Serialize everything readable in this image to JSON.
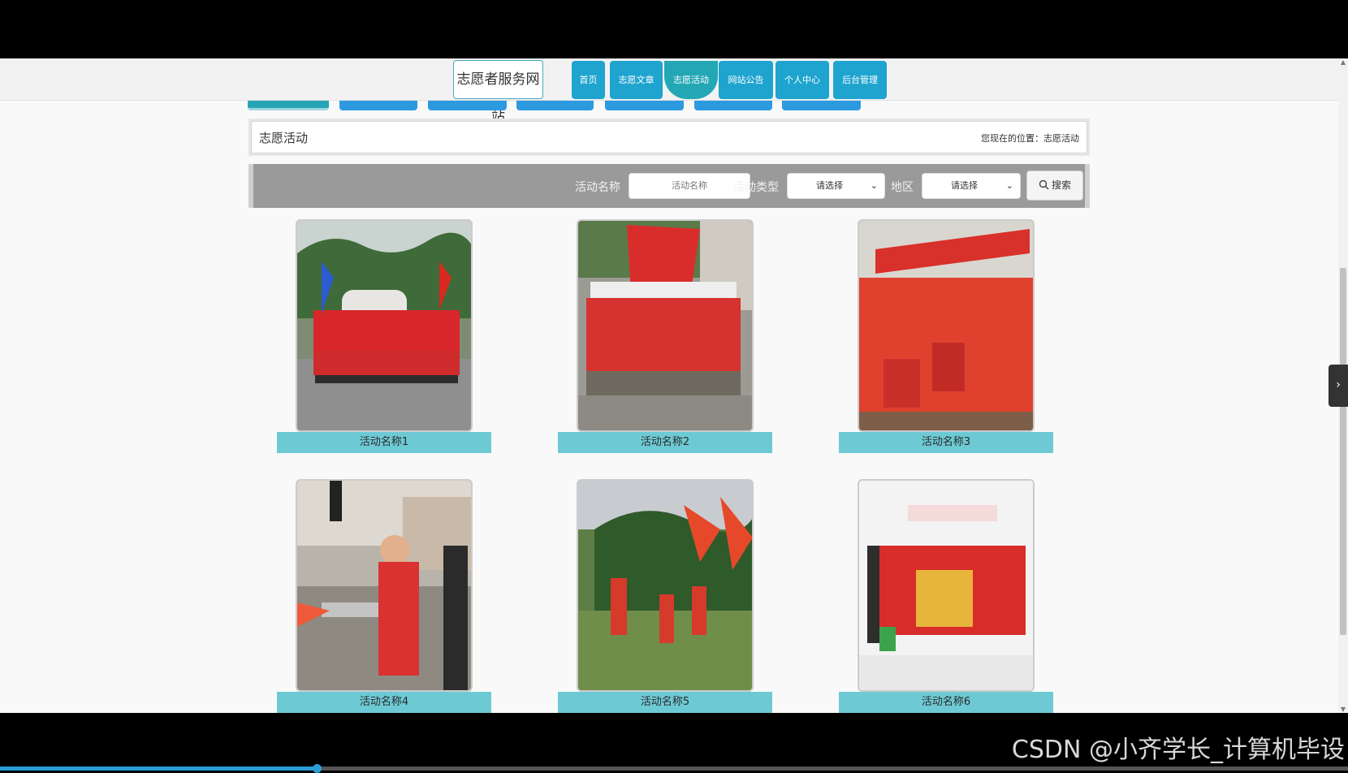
{
  "site": {
    "title": "志愿者服务网站"
  },
  "nav": {
    "items": [
      {
        "label": "首页"
      },
      {
        "label": "志愿文章"
      },
      {
        "label": "志愿活动",
        "active": true
      },
      {
        "label": "网站公告"
      },
      {
        "label": "个人中心"
      },
      {
        "label": "后台管理"
      }
    ]
  },
  "breadcrumb": {
    "title": "志愿活动",
    "location": "您现在的位置：志愿活动"
  },
  "search": {
    "name_label": "活动名称",
    "name_placeholder": "活动名称",
    "type_label": "活动类型",
    "type_value": "请选择",
    "region_label": "地区",
    "region_value": "请选择",
    "button_label": "搜索"
  },
  "activities": [
    {
      "name": "活动名称1"
    },
    {
      "name": "活动名称2"
    },
    {
      "name": "活动名称3"
    },
    {
      "name": "活动名称4"
    },
    {
      "name": "活动名称5"
    },
    {
      "name": "活动名称6"
    }
  ],
  "watermark": "CSDN @小齐学长_计算机毕设",
  "video": {
    "progress": 0.235
  },
  "colors": {
    "nav": "#1ea4cf",
    "nav_active": "#23a7b5",
    "card_label": "#6dcad5",
    "search_bar": "#9a9a9a"
  }
}
